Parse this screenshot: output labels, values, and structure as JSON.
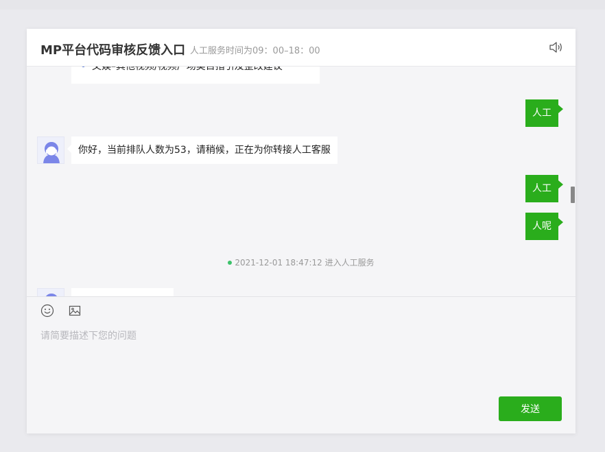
{
  "header": {
    "title": "MP平台代码审核反馈入口",
    "subtitle": "人工服务时间为09：00–18：00"
  },
  "icons": {
    "sound": "speaker-icon",
    "emoji": "smiley-icon",
    "image": "image-icon",
    "option_chevron": "›"
  },
  "chat": {
    "option_item": "文娱–其他视频/视频广场类目指引及整改建议",
    "messages": [
      {
        "side": "right",
        "text": "人工"
      },
      {
        "side": "left",
        "text": "你好，当前排队人数为53，请稍候，正在为你转接人工客服"
      },
      {
        "side": "right",
        "text": "人工"
      },
      {
        "side": "right",
        "text": "人呢"
      }
    ],
    "system_notice": "2021-12-01 18:47:12 进入人工服务"
  },
  "composer": {
    "placeholder": "请简要描述下您的问题",
    "value": "",
    "send_label": "发送"
  },
  "colors": {
    "accent": "#2aad1c",
    "status_dot": "#3cc26a"
  }
}
